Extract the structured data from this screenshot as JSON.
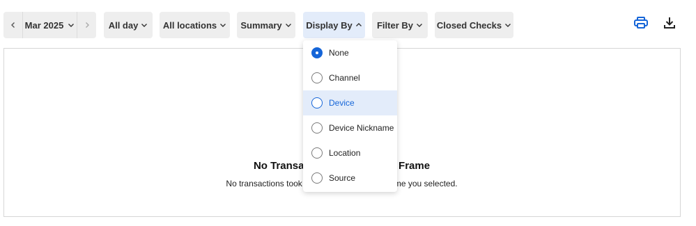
{
  "toolbar": {
    "prev_icon": "chevron-left-icon",
    "month": "Mar 2025",
    "next_icon": "chevron-right-icon",
    "time_filter": "All day",
    "locations_filter": "All locations",
    "report_type": "Summary",
    "display_by": "Display By",
    "filter_by": "Filter By",
    "checks_filter": "Closed Checks",
    "print_icon": "printer-icon",
    "download_icon": "download-icon"
  },
  "display_by_menu": {
    "selected": "None",
    "hovered": "Device",
    "options": [
      "None",
      "Channel",
      "Device",
      "Device Nickname",
      "Location",
      "Source"
    ]
  },
  "empty_state": {
    "title": "No Transactions in this Time Frame",
    "message": "No transactions took place during the time frame you selected."
  },
  "colors": {
    "accent": "#1565d8",
    "pill_background": "#eeeeee",
    "active_pill_background": "#e3ecfa"
  }
}
